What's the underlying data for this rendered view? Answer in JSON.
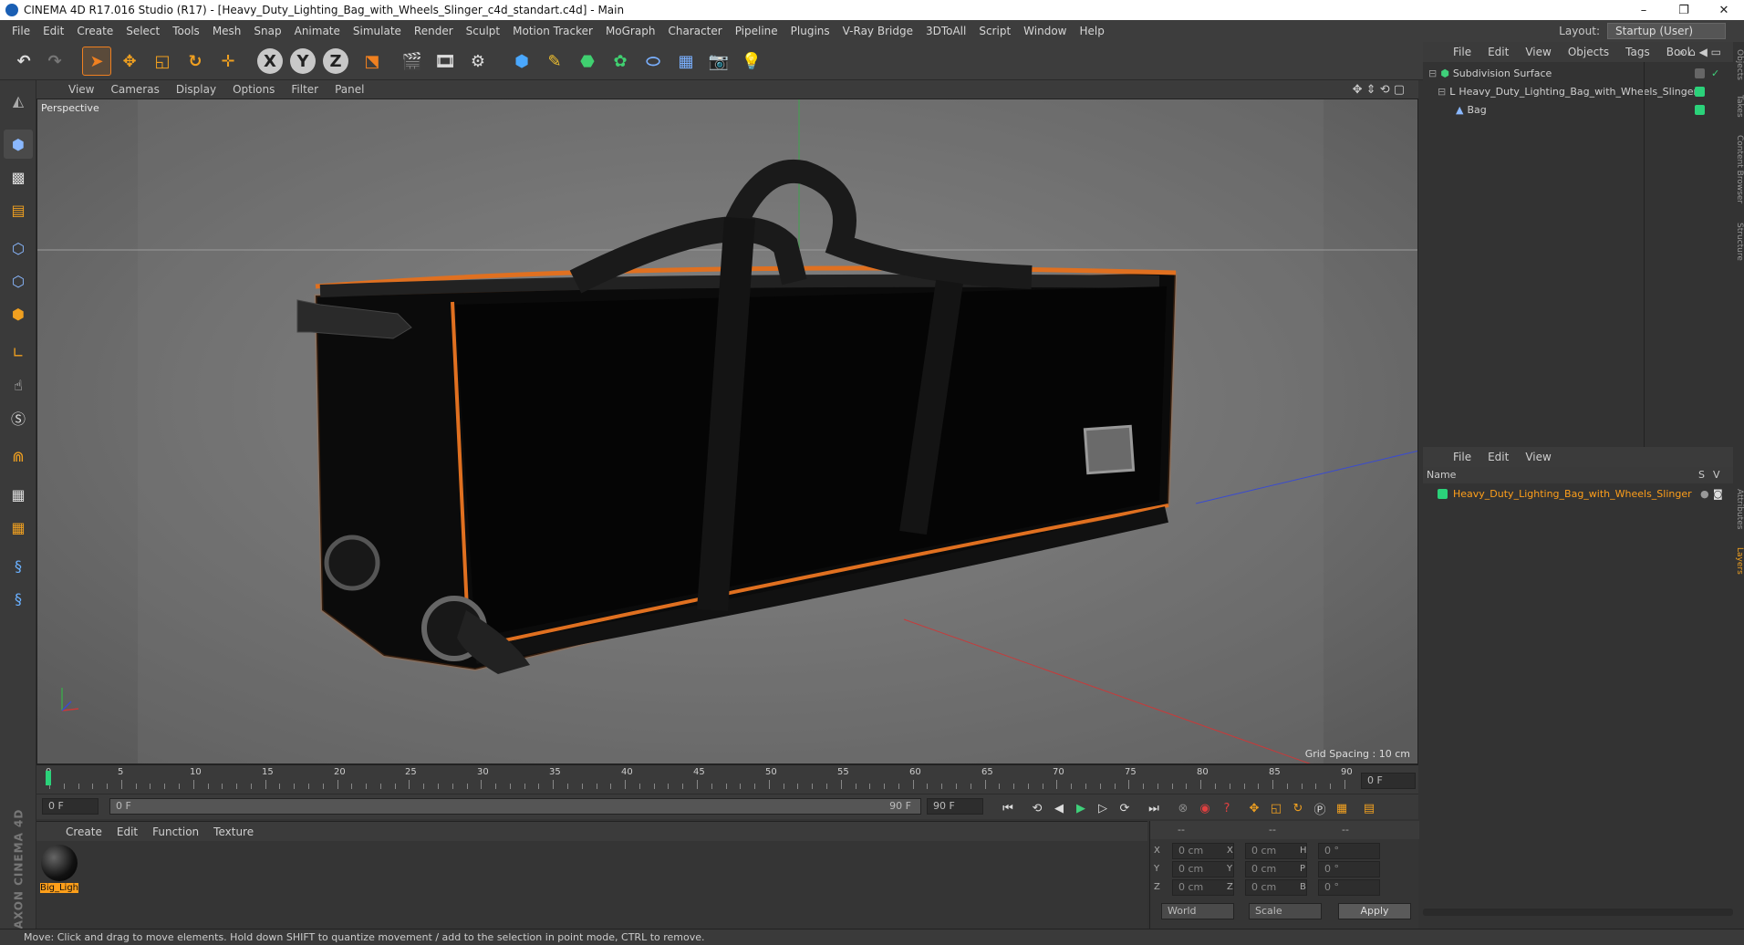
{
  "window": {
    "title": "CINEMA 4D R17.016 Studio (R17) - [Heavy_Duty_Lighting_Bag_with_Wheels_Slinger_c4d_standart.c4d] - Main",
    "min": "–",
    "restore": "❐",
    "close": "✕"
  },
  "menu": [
    "File",
    "Edit",
    "Create",
    "Select",
    "Tools",
    "Mesh",
    "Snap",
    "Animate",
    "Simulate",
    "Render",
    "Sculpt",
    "Motion Tracker",
    "MoGraph",
    "Character",
    "Pipeline",
    "Plugins",
    "V-Ray Bridge",
    "3DToAll",
    "Script",
    "Window",
    "Help"
  ],
  "layout": {
    "label": "Layout:",
    "value": "Startup (User)"
  },
  "toolbar": {
    "axis_x": "X",
    "axis_y": "Y",
    "axis_z": "Z"
  },
  "viewport": {
    "menu": [
      "View",
      "Cameras",
      "Display",
      "Options",
      "Filter",
      "Panel"
    ],
    "label": "Perspective",
    "grid_spacing": "Grid Spacing : 10 cm"
  },
  "objects_panel": {
    "menu": [
      "File",
      "Edit",
      "View",
      "Objects",
      "Tags",
      "Bool"
    ],
    "items": [
      {
        "name": "Subdivision Surface"
      },
      {
        "name": "Heavy_Duty_Lighting_Bag_with_Wheels_Slinger"
      },
      {
        "name": "Bag"
      }
    ]
  },
  "layers_panel": {
    "menu": [
      "File",
      "Edit",
      "View"
    ],
    "col_name": "Name",
    "col_s": "S",
    "col_v": "V",
    "item": "Heavy_Duty_Lighting_Bag_with_Wheels_Slinger"
  },
  "side_tabs": [
    "Objects",
    "Takes",
    "Content Browser",
    "Structure",
    "Attributes",
    "Layers"
  ],
  "timeline": {
    "ticks": [
      "0",
      "5",
      "10",
      "15",
      "20",
      "25",
      "30",
      "35",
      "40",
      "45",
      "50",
      "55",
      "60",
      "65",
      "70",
      "75",
      "80",
      "85",
      "90"
    ],
    "current": "0 F",
    "start": "0 F",
    "range_start": "0 F",
    "range_end": "90 F",
    "end": "90 F"
  },
  "materials": {
    "menu": [
      "Create",
      "Edit",
      "Function",
      "Texture"
    ],
    "items": [
      {
        "name": "Big_Ligh"
      }
    ]
  },
  "coords": {
    "header": [
      "--",
      "--",
      "--"
    ],
    "rows": [
      {
        "a": "X",
        "av": "0 cm",
        "b": "X",
        "bv": "0 cm",
        "c": "H",
        "cv": "0 °"
      },
      {
        "a": "Y",
        "av": "0 cm",
        "b": "Y",
        "bv": "0 cm",
        "c": "P",
        "cv": "0 °"
      },
      {
        "a": "Z",
        "av": "0 cm",
        "b": "Z",
        "bv": "0 cm",
        "c": "B",
        "cv": "0 °"
      }
    ],
    "mode": "World",
    "scale": "Scale",
    "apply": "Apply"
  },
  "status": "Move: Click and drag to move elements. Hold down SHIFT to quantize movement / add to the selection in point mode, CTRL to remove.",
  "brand": "MAXON CINEMA 4D",
  "colors": {
    "accent": "#2a7fd4",
    "tag_green": "#2bd27a",
    "selected": "#ff9f1a",
    "bag_trim": "#e07020"
  }
}
